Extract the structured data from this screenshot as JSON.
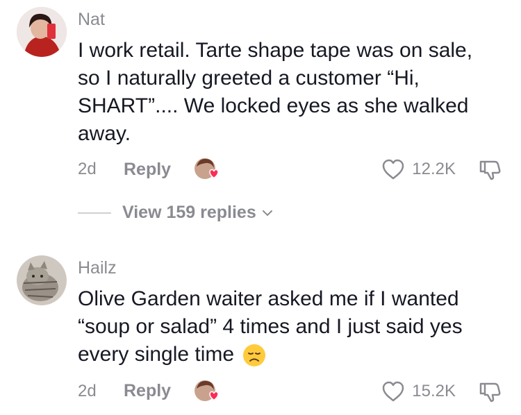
{
  "comments": [
    {
      "username": "Nat",
      "text_lines": [
        "I work retail. Tarte shape tape was on sale,",
        "so I naturally greeted a customer “Hi,",
        "SHART”.... We locked eyes as she walked",
        "away."
      ],
      "age": "2d",
      "reply_label": "Reply",
      "likes": "12.2K",
      "view_replies": "View 159 replies"
    },
    {
      "username": "Hailz",
      "text_lines": [
        "Olive Garden waiter asked me if I wanted",
        "“soup or salad” 4 times and I just said yes",
        "every single time"
      ],
      "emoji": "disappointed-face-emoji",
      "age": "2d",
      "reply_label": "Reply",
      "likes": "15.2K"
    }
  ],
  "colors": {
    "text": "#161823",
    "muted": "#8a8b91",
    "heart_badge": "#fe2c55"
  },
  "icons": [
    "heart-outline-icon",
    "thumbs-down-icon",
    "chevron-down-icon",
    "creator-liked-badge-icon"
  ]
}
